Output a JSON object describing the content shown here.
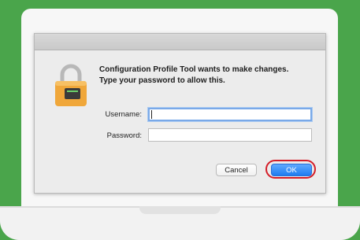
{
  "dialog": {
    "message_line1": "Configuration Profile Tool wants to make changes.",
    "message_line2": "Type your password to allow this.",
    "username_label": "Username:",
    "username_value": "",
    "password_label": "Password:",
    "password_value": "",
    "cancel_label": "Cancel",
    "ok_label": "OK",
    "icon": "lock-icon"
  },
  "colors": {
    "background": "#4aa54b",
    "ok_button": "#1f7cf0",
    "highlight": "#d41d28"
  }
}
